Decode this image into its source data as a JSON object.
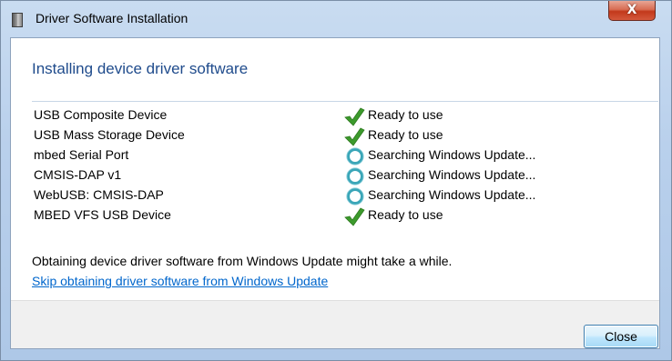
{
  "window": {
    "title": "Driver Software Installation",
    "close_glyph": "X"
  },
  "main": {
    "heading": "Installing device driver software",
    "devices": [
      {
        "name": "USB Composite Device",
        "status": "Ready to use",
        "icon": "checkmark-icon"
      },
      {
        "name": "USB Mass Storage Device",
        "status": "Ready to use",
        "icon": "checkmark-icon"
      },
      {
        "name": "mbed Serial Port",
        "status": "Searching Windows Update...",
        "icon": "searching-spinner-icon"
      },
      {
        "name": "CMSIS-DAP v1",
        "status": "Searching Windows Update...",
        "icon": "searching-spinner-icon"
      },
      {
        "name": "WebUSB: CMSIS-DAP",
        "status": "Searching Windows Update...",
        "icon": "searching-spinner-icon"
      },
      {
        "name": "MBED VFS USB Device",
        "status": "Ready to use",
        "icon": "checkmark-icon"
      }
    ],
    "note": "Obtaining device driver software from Windows Update might take a while.",
    "skip_link": "Skip obtaining driver software from Windows Update"
  },
  "footer": {
    "close_label": "Close"
  },
  "colors": {
    "heading": "#1f4b8c",
    "link": "#0066cc",
    "check_green": "#3c9a2c",
    "spinner_teal": "#3aa6b8"
  }
}
